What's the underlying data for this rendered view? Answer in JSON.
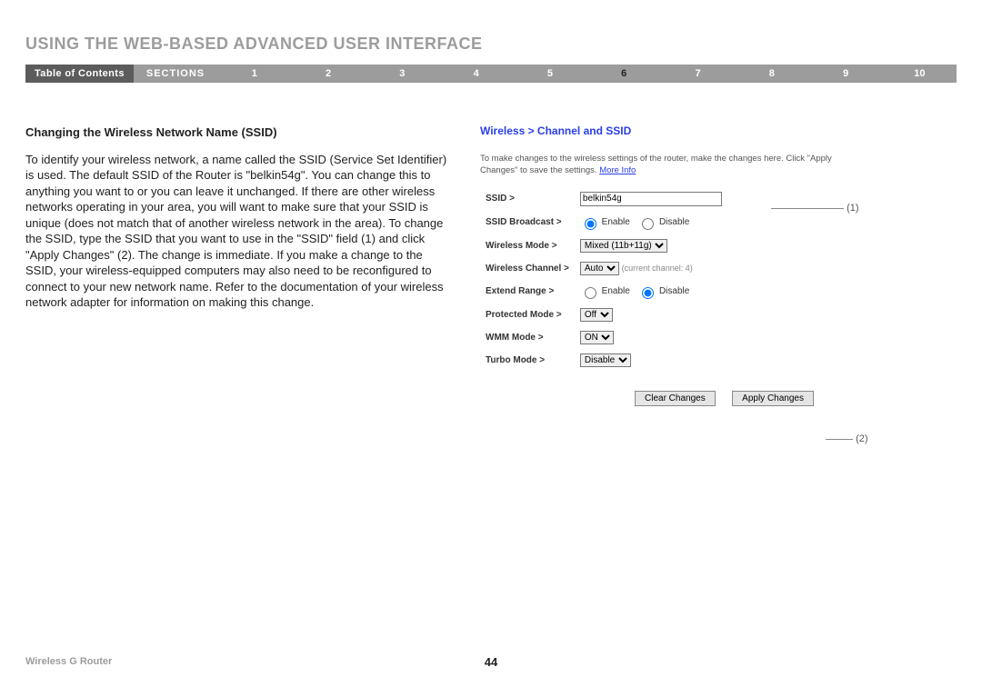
{
  "header": {
    "title": "USING THE WEB-BASED ADVANCED USER INTERFACE"
  },
  "nav": {
    "toc_label": "Table of Contents",
    "sections_label": "SECTIONS",
    "numbers": [
      "1",
      "2",
      "3",
      "4",
      "5",
      "6",
      "7",
      "8",
      "9",
      "10"
    ],
    "active_index": 5
  },
  "section": {
    "heading": "Changing the Wireless Network Name (SSID)",
    "body": "To identify your wireless network, a name called the SSID (Service Set Identifier) is used. The default SSID of the Router is \"belkin54g\". You can change this to anything you want to or you can leave it unchanged. If there are other wireless networks operating in your area, you will want to make sure that your SSID is unique (does not match that of another wireless network in the area). To change the SSID, type the SSID that you want to use in the \"SSID\" field (1) and click \"Apply Changes\" (2). The change is immediate. If you make a change to the SSID, your wireless-equipped computers may also need to be reconfigured to connect to your new network name. Refer to the documentation of your wireless network adapter for information on making this change."
  },
  "panel": {
    "breadcrumb": "Wireless > Channel and SSID",
    "instructions": "To make changes to the wireless settings of the router, make the changes here. Click \"Apply Changes\" to save the settings.",
    "more_info": "More Info",
    "labels": {
      "ssid": "SSID >",
      "broadcast": "SSID Broadcast >",
      "mode": "Wireless Mode >",
      "channel": "Wireless Channel >",
      "extend": "Extend Range >",
      "protected": "Protected Mode >",
      "wmm": "WMM Mode >",
      "turbo": "Turbo Mode >"
    },
    "values": {
      "ssid": "belkin54g",
      "broadcast_enable": "Enable",
      "broadcast_disable": "Disable",
      "mode": "Mixed (11b+11g)",
      "channel": "Auto",
      "channel_note": "(current channel: 4)",
      "extend_enable": "Enable",
      "extend_disable": "Disable",
      "protected": "Off",
      "wmm": "ON",
      "turbo": "Disable"
    },
    "buttons": {
      "clear": "Clear Changes",
      "apply": "Apply Changes"
    },
    "callouts": {
      "c1": "(1)",
      "c2": "(2)"
    }
  },
  "footer": {
    "product": "Wireless G Router",
    "page": "44"
  }
}
